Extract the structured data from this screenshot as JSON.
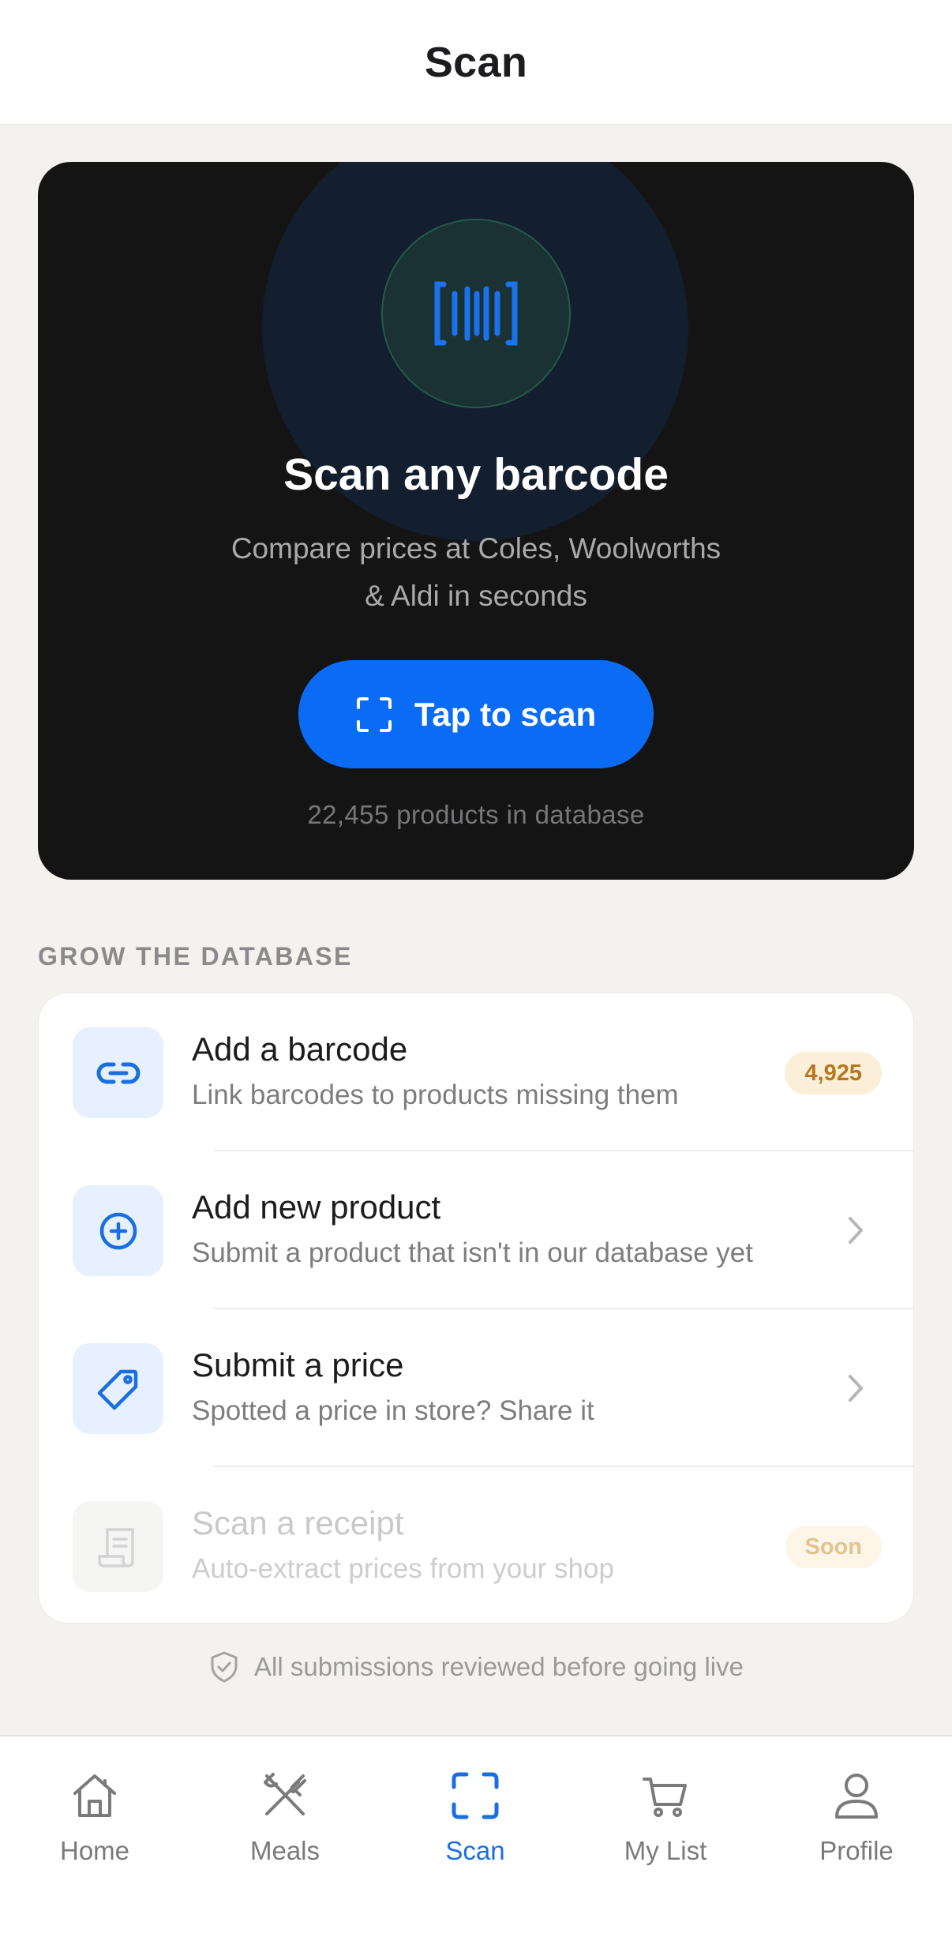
{
  "header": {
    "title": "Scan"
  },
  "hero": {
    "icon": "barcode-icon",
    "title": "Scan any barcode",
    "subtitle_line1": "Compare prices at Coles, Woolworths",
    "subtitle_line2": "& Aldi in seconds",
    "button_icon": "scan-frame-icon",
    "button_label": "Tap to scan",
    "product_count": "22,455 products in database"
  },
  "grow": {
    "section_label": "GROW THE DATABASE",
    "items": [
      {
        "icon": "link-icon",
        "title": "Add a barcode",
        "subtitle": "Link barcodes to products missing them",
        "badge": "4,925"
      },
      {
        "icon": "plus-circle-icon",
        "title": "Add new product",
        "subtitle": "Submit a product that isn't in our database yet",
        "trailing": "chevron-right-icon"
      },
      {
        "icon": "price-tag-icon",
        "title": "Submit a price",
        "subtitle": "Spotted a price in store? Share it",
        "trailing": "chevron-right-icon"
      },
      {
        "icon": "receipt-icon",
        "title": "Scan a receipt",
        "subtitle": "Auto-extract prices from your shop",
        "badge": "Soon",
        "disabled": true
      }
    ]
  },
  "footnote": {
    "icon": "shield-check-icon",
    "text": "All submissions reviewed before going live"
  },
  "tabbar": {
    "active": "Scan",
    "tabs": [
      {
        "icon": "home-icon",
        "label": "Home"
      },
      {
        "icon": "utensils-icon",
        "label": "Meals"
      },
      {
        "icon": "scan-frame-icon",
        "label": "Scan"
      },
      {
        "icon": "cart-icon",
        "label": "My List"
      },
      {
        "icon": "user-icon",
        "label": "Profile"
      }
    ]
  },
  "colors": {
    "accent": "#0a6cf5",
    "hero_background": "#141414",
    "badge_background": "#fcefd9",
    "badge_text": "#b5781e",
    "page_background": "#f3f2ee"
  }
}
